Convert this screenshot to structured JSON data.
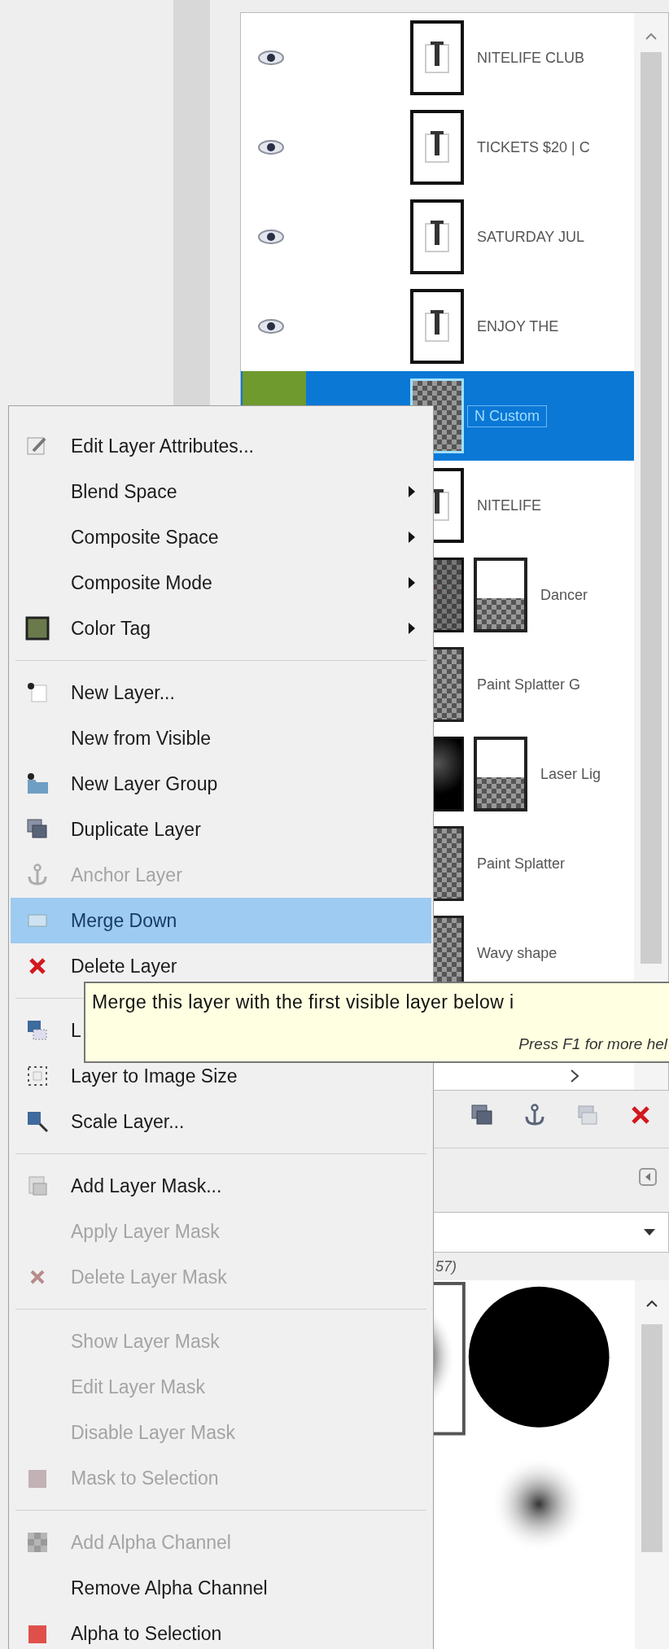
{
  "layers": [
    {
      "name": "NITELIFE CLUB",
      "kind": "text",
      "mask": false,
      "visible": true,
      "selected": false
    },
    {
      "name": "TICKETS $20 | C",
      "kind": "text",
      "mask": false,
      "visible": true,
      "selected": false
    },
    {
      "name": "SATURDAY JUL",
      "kind": "text",
      "mask": false,
      "visible": true,
      "selected": false
    },
    {
      "name": "ENJOY THE",
      "kind": "text",
      "mask": false,
      "visible": true,
      "selected": false
    },
    {
      "name": "N Custom",
      "kind": "checker",
      "mask": false,
      "selected": true,
      "color": "#6f9a2d"
    },
    {
      "name": "NITELIFE",
      "kind": "text",
      "mask": false,
      "selected": false
    },
    {
      "name": "Dancer",
      "kind": "photo",
      "mask": true,
      "selected": false
    },
    {
      "name": "Paint Splatter G",
      "kind": "checker",
      "mask": false,
      "selected": false
    },
    {
      "name": "Laser Lig",
      "kind": "dark",
      "mask": true,
      "selected": false
    },
    {
      "name": "Paint Splatter",
      "kind": "checker",
      "mask": false,
      "selected": false
    },
    {
      "name": "Wavy shape",
      "kind": "checker",
      "mask": false,
      "selected": false
    }
  ],
  "context_menu": {
    "sections": [
      [
        {
          "label": "Edit Layer Attributes...",
          "disabled": false,
          "submenu": false,
          "selected": false
        },
        {
          "label": "Blend Space",
          "disabled": false,
          "submenu": true,
          "selected": false
        },
        {
          "label": "Composite Space",
          "disabled": false,
          "submenu": true,
          "selected": false
        },
        {
          "label": "Composite Mode",
          "disabled": false,
          "submenu": true,
          "selected": false
        },
        {
          "label": "Color Tag",
          "disabled": false,
          "submenu": true,
          "selected": false
        }
      ],
      [
        {
          "label": "New Layer...",
          "disabled": false,
          "submenu": false,
          "selected": false
        },
        {
          "label": "New from Visible",
          "disabled": false,
          "submenu": false,
          "selected": false
        },
        {
          "label": "New Layer Group",
          "disabled": false,
          "submenu": false,
          "selected": false
        },
        {
          "label": "Duplicate Layer",
          "disabled": false,
          "submenu": false,
          "selected": false
        },
        {
          "label": "Anchor Layer",
          "disabled": true,
          "submenu": false,
          "selected": false
        },
        {
          "label": "Merge Down",
          "disabled": false,
          "submenu": false,
          "selected": true
        },
        {
          "label": "Delete Layer",
          "disabled": false,
          "submenu": false,
          "selected": false
        }
      ],
      [
        {
          "label": "L",
          "disabled": false,
          "submenu": false,
          "selected": false
        },
        {
          "label": "Layer to Image Size",
          "disabled": false,
          "submenu": false,
          "selected": false
        },
        {
          "label": "Scale Layer...",
          "disabled": false,
          "submenu": false,
          "selected": false
        }
      ],
      [
        {
          "label": "Add Layer Mask...",
          "disabled": false,
          "submenu": false,
          "selected": false
        },
        {
          "label": "Apply Layer Mask",
          "disabled": true,
          "submenu": false,
          "selected": false
        },
        {
          "label": "Delete Layer Mask",
          "disabled": true,
          "submenu": false,
          "selected": false
        }
      ],
      [
        {
          "label": "Show Layer Mask",
          "disabled": true,
          "submenu": false,
          "selected": false
        },
        {
          "label": "Edit Layer Mask",
          "disabled": true,
          "submenu": false,
          "selected": false
        },
        {
          "label": "Disable Layer Mask",
          "disabled": true,
          "submenu": false,
          "selected": false
        },
        {
          "label": "Mask to Selection",
          "disabled": true,
          "submenu": false,
          "selected": false
        }
      ],
      [
        {
          "label": "Add Alpha Channel",
          "disabled": true,
          "submenu": false,
          "selected": false
        },
        {
          "label": "Remove Alpha Channel",
          "disabled": false,
          "submenu": false,
          "selected": false
        },
        {
          "label": "Alpha to Selection",
          "disabled": false,
          "submenu": false,
          "selected": false
        }
      ]
    ]
  },
  "tooltip": {
    "text": "Merge this layer with the first visible layer below i",
    "hint": "Press F1 for more hel"
  },
  "brushes": {
    "size_label": "57)"
  }
}
